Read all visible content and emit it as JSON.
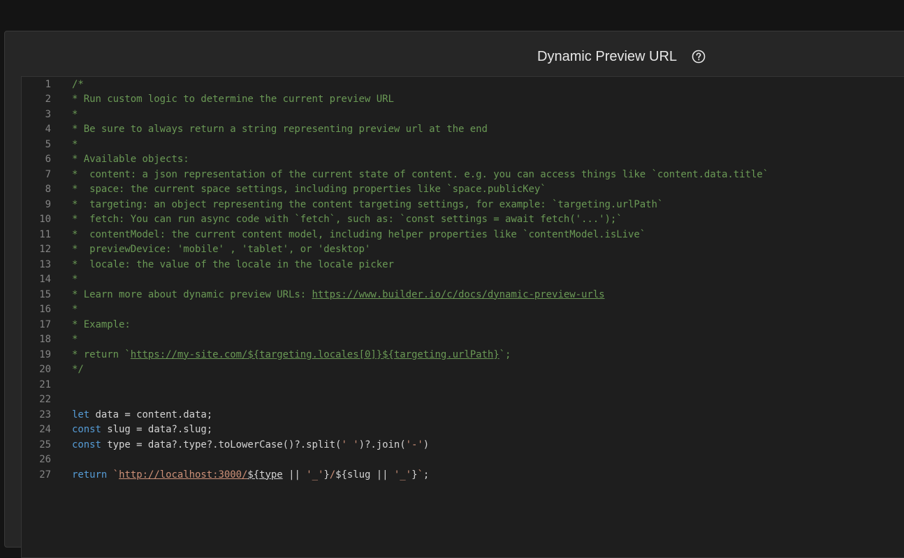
{
  "dialog": {
    "title": "Dynamic Preview URL",
    "help_icon": "help-circle-icon"
  },
  "editor": {
    "lines": [
      {
        "n": "1",
        "tokens": [
          {
            "t": "comment",
            "v": "/*"
          }
        ]
      },
      {
        "n": "2",
        "tokens": [
          {
            "t": "comment",
            "v": "* Run custom logic to determine the current preview URL"
          }
        ]
      },
      {
        "n": "3",
        "tokens": [
          {
            "t": "comment",
            "v": "*"
          }
        ]
      },
      {
        "n": "4",
        "tokens": [
          {
            "t": "comment",
            "v": "* Be sure to always return a string representing preview url at the end"
          }
        ]
      },
      {
        "n": "5",
        "tokens": [
          {
            "t": "comment",
            "v": "*"
          }
        ]
      },
      {
        "n": "6",
        "tokens": [
          {
            "t": "comment",
            "v": "* Available objects:"
          }
        ]
      },
      {
        "n": "7",
        "tokens": [
          {
            "t": "comment",
            "v": "*  content: a json representation of the current state of content. e.g. you can access things like `content.data.title`"
          }
        ]
      },
      {
        "n": "8",
        "tokens": [
          {
            "t": "comment",
            "v": "*  space: the current space settings, including properties like `space.publicKey`"
          }
        ]
      },
      {
        "n": "9",
        "tokens": [
          {
            "t": "comment",
            "v": "*  targeting: an object representing the content targeting settings, for example: `targeting.urlPath`"
          }
        ]
      },
      {
        "n": "10",
        "tokens": [
          {
            "t": "comment",
            "v": "*  fetch: You can run async code with `fetch`, such as: `const settings = await fetch('...');`"
          }
        ]
      },
      {
        "n": "11",
        "tokens": [
          {
            "t": "comment",
            "v": "*  contentModel: the current content model, including helper properties like `contentModel.isLive`"
          }
        ]
      },
      {
        "n": "12",
        "tokens": [
          {
            "t": "comment",
            "v": "*  previewDevice: 'mobile' , 'tablet', or 'desktop'"
          }
        ]
      },
      {
        "n": "13",
        "tokens": [
          {
            "t": "comment",
            "v": "*  locale: the value of the locale in the locale picker"
          }
        ]
      },
      {
        "n": "14",
        "tokens": [
          {
            "t": "comment",
            "v": "*"
          }
        ]
      },
      {
        "n": "15",
        "tokens": [
          {
            "t": "comment",
            "v": "* Learn more about dynamic preview URLs: "
          },
          {
            "t": "link",
            "v": "https://www.builder.io/c/docs/dynamic-preview-urls"
          }
        ]
      },
      {
        "n": "16",
        "tokens": [
          {
            "t": "comment",
            "v": "*"
          }
        ]
      },
      {
        "n": "17",
        "tokens": [
          {
            "t": "comment",
            "v": "* Example:"
          }
        ]
      },
      {
        "n": "18",
        "tokens": [
          {
            "t": "comment",
            "v": "*"
          }
        ]
      },
      {
        "n": "19",
        "tokens": [
          {
            "t": "comment",
            "v": "* return `"
          },
          {
            "t": "link",
            "v": "https://my-site.com/${targeting.locales[0]}${targeting.urlPath}"
          },
          {
            "t": "comment",
            "v": "`;"
          }
        ]
      },
      {
        "n": "20",
        "tokens": [
          {
            "t": "comment",
            "v": "*/"
          }
        ]
      },
      {
        "n": "21",
        "tokens": []
      },
      {
        "n": "22",
        "tokens": []
      },
      {
        "n": "23",
        "tokens": [
          {
            "t": "kw",
            "v": "let"
          },
          {
            "t": "plain",
            "v": " data = content.data;"
          }
        ]
      },
      {
        "n": "24",
        "tokens": [
          {
            "t": "kw",
            "v": "const"
          },
          {
            "t": "plain",
            "v": " slug = data?.slug;"
          }
        ]
      },
      {
        "n": "25",
        "tokens": [
          {
            "t": "kw",
            "v": "const"
          },
          {
            "t": "plain",
            "v": " type = data?.type?.toLowerCase()?.split("
          },
          {
            "t": "str",
            "v": "' '"
          },
          {
            "t": "plain",
            "v": ")?.join("
          },
          {
            "t": "str",
            "v": "'-'"
          },
          {
            "t": "plain",
            "v": ")"
          }
        ]
      },
      {
        "n": "26",
        "tokens": []
      },
      {
        "n": "27",
        "tokens": [
          {
            "t": "kw",
            "v": "return"
          },
          {
            "t": "plain",
            "v": " "
          },
          {
            "t": "str",
            "v": "`"
          },
          {
            "t": "strlink",
            "v": "http://localhost:3000/"
          },
          {
            "t": "plainlink",
            "v": "${type"
          },
          {
            "t": "plain",
            "v": " || "
          },
          {
            "t": "str",
            "v": "'_'"
          },
          {
            "t": "plain",
            "v": "}"
          },
          {
            "t": "str",
            "v": "/"
          },
          {
            "t": "plain",
            "v": "${slug || "
          },
          {
            "t": "str",
            "v": "'_'"
          },
          {
            "t": "plain",
            "v": "}"
          },
          {
            "t": "str",
            "v": "`"
          },
          {
            "t": "plain",
            "v": ";"
          }
        ]
      }
    ]
  }
}
